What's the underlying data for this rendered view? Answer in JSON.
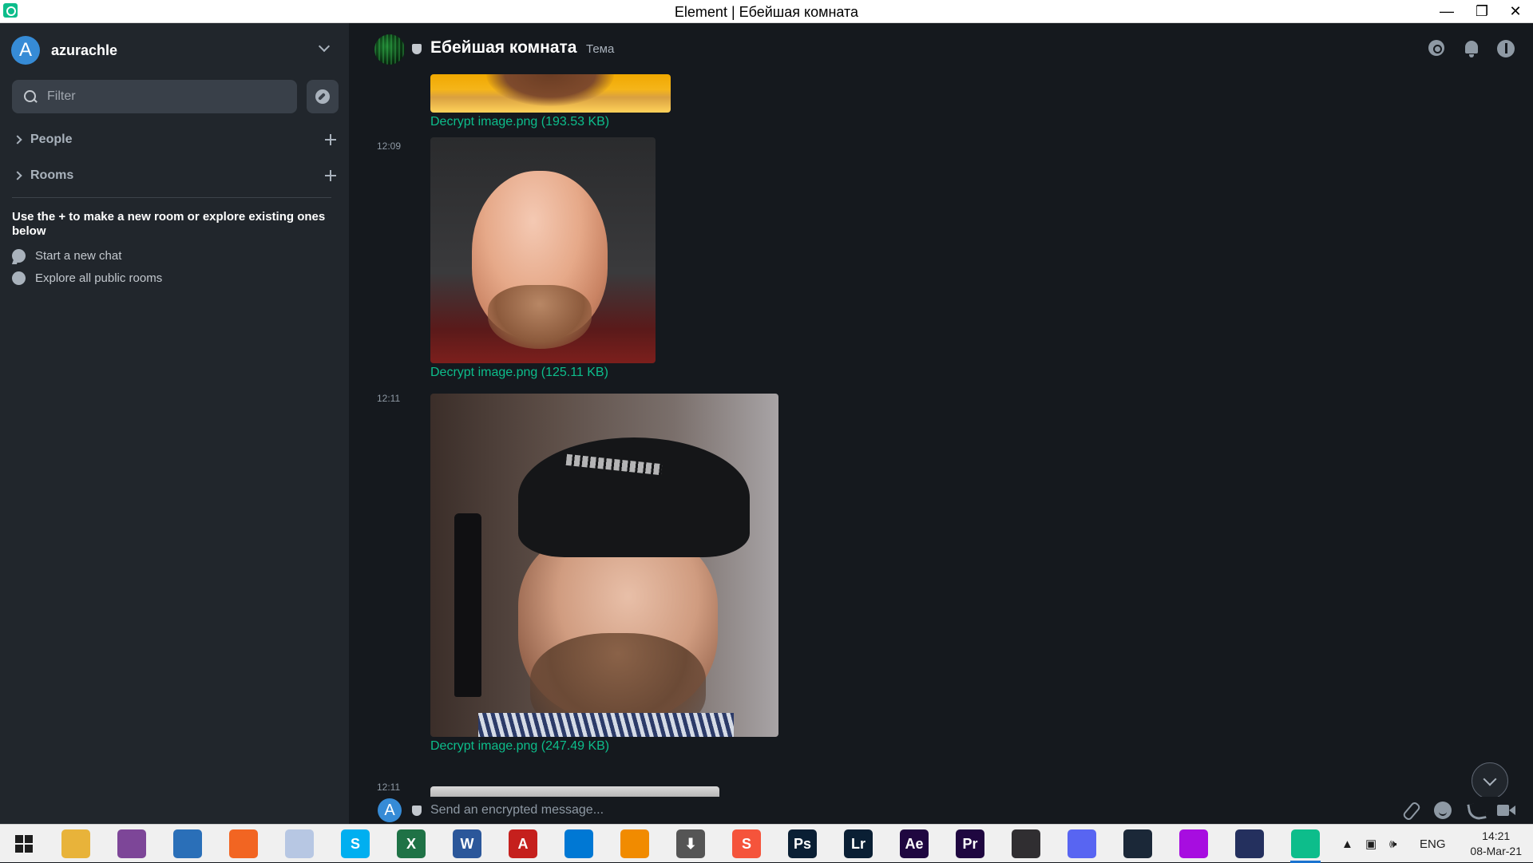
{
  "window": {
    "title": "Element | Ебейшая комната",
    "minimize_glyph": "—",
    "restore_glyph": "❐",
    "close_glyph": "✕"
  },
  "sidebar": {
    "user": {
      "avatar_letter": "A",
      "name": "azurachle"
    },
    "filter_placeholder": "Filter",
    "sections": [
      {
        "label": "People"
      },
      {
        "label": "Rooms"
      }
    ],
    "hint": "Use the + to make a new room or explore existing ones below",
    "links": [
      {
        "label": "Start a new chat",
        "icon": "chat-bubble-icon"
      },
      {
        "label": "Explore all public rooms",
        "icon": "compass-icon"
      }
    ]
  },
  "room": {
    "name": "Ебейшая комната",
    "topic": "Тема"
  },
  "timeline": {
    "events": [
      {
        "time": "",
        "file": "Decrypt image.png (193.53 KB)"
      },
      {
        "time": "12:09",
        "file": "Decrypt image.png (125.11 KB)"
      },
      {
        "time": "12:11",
        "file": "Decrypt image.png (247.49 KB)"
      },
      {
        "time": "12:11",
        "file": ""
      }
    ]
  },
  "composer": {
    "avatar_letter": "A",
    "placeholder": "Send an encrypted message..."
  },
  "taskbar": {
    "apps": [
      {
        "name": "file-explorer-icon",
        "glyph": "",
        "color": "#e8b33a"
      },
      {
        "name": "tor-icon",
        "glyph": "",
        "color": "#7d4698"
      },
      {
        "name": "browser-globe-icon",
        "glyph": "",
        "color": "#2a6fb8"
      },
      {
        "name": "firefox-icon",
        "glyph": "",
        "color": "#f26522"
      },
      {
        "name": "waterfox-icon",
        "glyph": "",
        "color": "#b7c7e3"
      },
      {
        "name": "skype-icon",
        "glyph": "S",
        "color": "#00aff0"
      },
      {
        "name": "excel-icon",
        "glyph": "X",
        "color": "#1f7246"
      },
      {
        "name": "word-icon",
        "glyph": "W",
        "color": "#2b579a"
      },
      {
        "name": "acrobat-icon",
        "glyph": "A",
        "color": "#c5201d"
      },
      {
        "name": "vscode-icon",
        "glyph": "",
        "color": "#0078d4"
      },
      {
        "name": "vlc-icon",
        "glyph": "",
        "color": "#f18b00"
      },
      {
        "name": "download-icon",
        "glyph": "⬇",
        "color": "#555555"
      },
      {
        "name": "sublime-icon",
        "glyph": "S",
        "color": "#f5543b"
      },
      {
        "name": "photoshop-icon",
        "glyph": "Ps",
        "color": "#0a1f34"
      },
      {
        "name": "lightroom-icon",
        "glyph": "Lr",
        "color": "#0a1f34"
      },
      {
        "name": "after-effects-icon",
        "glyph": "Ae",
        "color": "#1f0740"
      },
      {
        "name": "premiere-icon",
        "glyph": "Pr",
        "color": "#1f0740"
      },
      {
        "name": "obs-icon",
        "glyph": "",
        "color": "#302e31"
      },
      {
        "name": "discord-icon",
        "glyph": "",
        "color": "#5865f2"
      },
      {
        "name": "steam-icon",
        "glyph": "",
        "color": "#1b2838"
      },
      {
        "name": "opera-icon",
        "glyph": "",
        "color": "#a70de0"
      },
      {
        "name": "vpn-lock-icon",
        "glyph": "",
        "color": "#24305e"
      },
      {
        "name": "element-icon",
        "glyph": "",
        "color": "#0dbd8b"
      }
    ],
    "tray_language": "ENG",
    "clock_time": "14:21",
    "clock_date": "08-Mar-21"
  },
  "colors": {
    "accent": "#0dbd8b",
    "avatar": "#368bd6",
    "sidebar_bg": "#21262c",
    "main_bg": "#15191e"
  }
}
